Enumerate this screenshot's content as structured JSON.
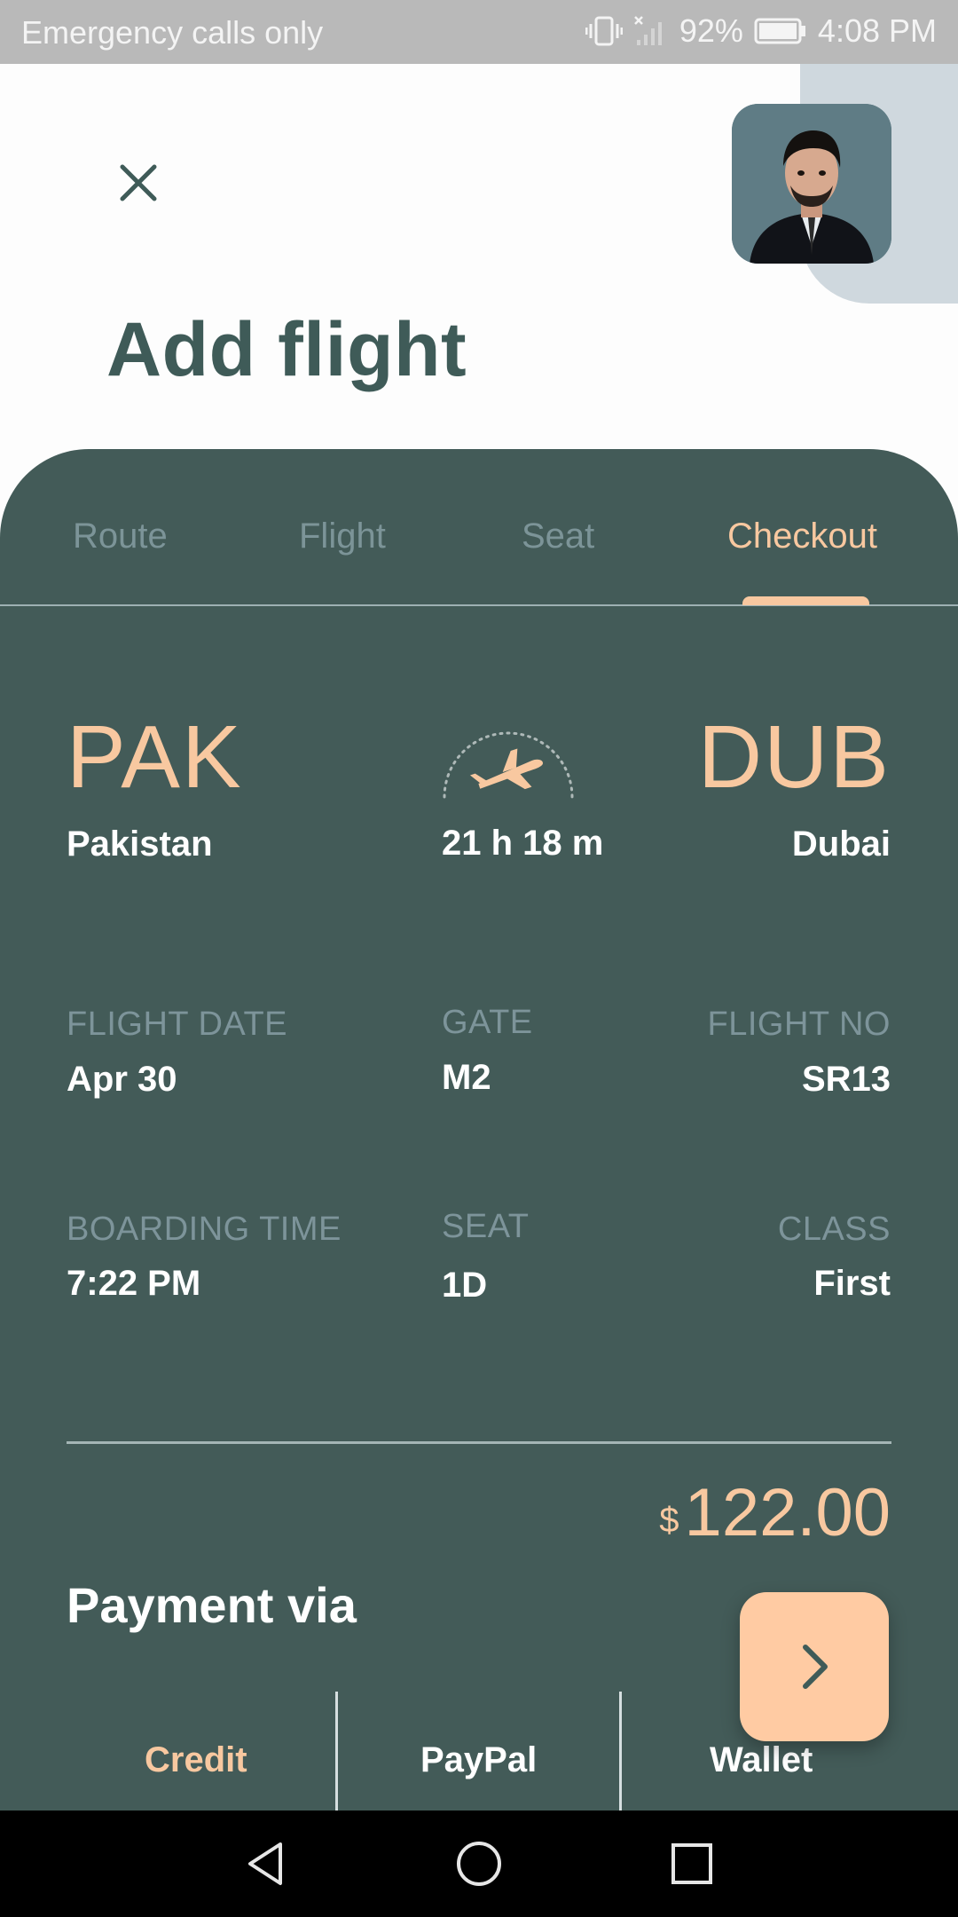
{
  "status_bar": {
    "carrier_text": "Emergency calls only",
    "battery": "92%",
    "time": "4:08 PM"
  },
  "header": {
    "title": "Add flight"
  },
  "tabs": [
    {
      "label": "Route",
      "active": false
    },
    {
      "label": "Flight",
      "active": false
    },
    {
      "label": "Seat",
      "active": false
    },
    {
      "label": "Checkout",
      "active": true
    }
  ],
  "route": {
    "origin_code": "PAK",
    "origin_city": "Pakistan",
    "duration": "21 h 18 m",
    "destination_code": "DUB",
    "destination_city": "Dubai"
  },
  "details": {
    "flight_date_label": "FLIGHT DATE",
    "flight_date": "Apr 30",
    "gate_label": "GATE",
    "gate": "M2",
    "flight_no_label": "FLIGHT NO",
    "flight_no": "SR13",
    "boarding_time_label": "BOARDING TIME",
    "boarding_time": "7:22 PM",
    "seat_label": "SEAT",
    "seat": "1D",
    "class_label": "CLASS",
    "class": "First"
  },
  "price": {
    "currency": "$",
    "amount": "122.00"
  },
  "payment": {
    "title": "Payment via",
    "options": [
      {
        "label": "Credit",
        "active": true
      },
      {
        "label": "PayPal",
        "active": false
      },
      {
        "label": "Wallet",
        "active": false
      }
    ]
  },
  "colors": {
    "card_bg": "#435b58",
    "accent": "#f8c8a0",
    "muted_label": "#7d949a",
    "title": "#3f5b58",
    "next_button": "#ffcba3"
  },
  "icons": {
    "close": "close-icon",
    "plane": "airplane-icon",
    "next": "chevron-right-icon"
  }
}
